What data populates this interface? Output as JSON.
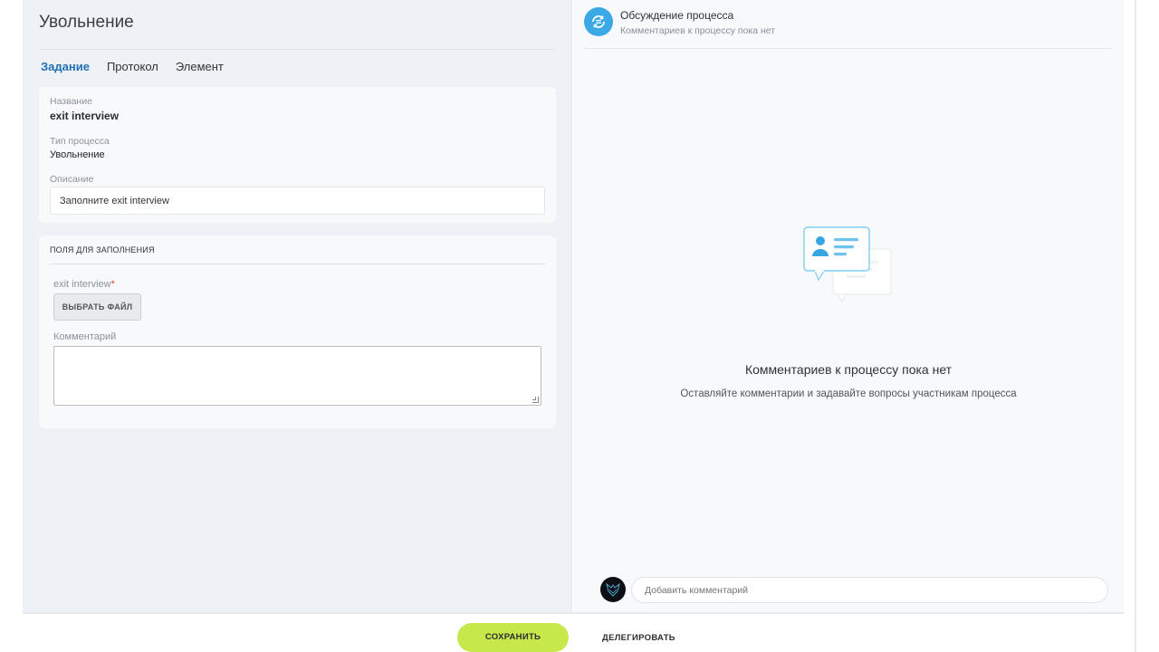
{
  "page": {
    "title": "Увольнение"
  },
  "tabs": [
    {
      "label": "Задание",
      "active": true
    },
    {
      "label": "Протокол",
      "active": false
    },
    {
      "label": "Элемент",
      "active": false
    }
  ],
  "task": {
    "name_label": "Название",
    "name_value": "exit interview",
    "type_label": "Тип процесса",
    "type_value": "Увольнение",
    "desc_label": "Описание",
    "desc_value": "Заполните exit interview"
  },
  "fields": {
    "section_title": "ПОЛЯ ДЛЯ ЗАПОЛНЕНИЯ",
    "file_label": "exit interview",
    "required_mark": "*",
    "file_button": "ВЫБРАТЬ ФАЙЛ",
    "comment_label": "Комментарий"
  },
  "discussion": {
    "title": "Обсуждение процесса",
    "subtitle": "Комментариев к процессу пока нет",
    "empty_title": "Комментариев к процессу пока нет",
    "empty_text": "Оставляйте комментарии и задавайте вопросы участникам процесса",
    "input_placeholder": "Добавить комментарий"
  },
  "footer": {
    "save_label": "СОХРАНИТЬ",
    "delegate_label": "ДЕЛЕГИРОВАТЬ"
  },
  "colors": {
    "accent_tab": "#1f6fb5",
    "save_button": "#c6e84a",
    "discussion_icon": "#3aa9e6",
    "required": "#e0462c"
  },
  "icons": {
    "discussion": "refresh-chat-icon",
    "empty_state": "chat-cards-icon",
    "avatar": "user-avatar"
  }
}
